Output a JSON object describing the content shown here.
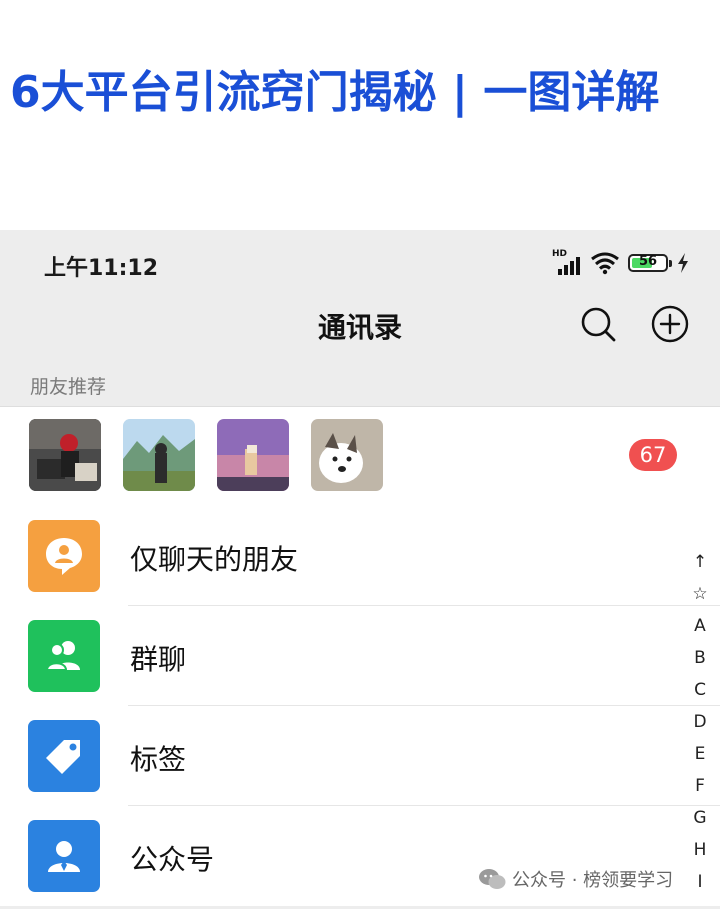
{
  "banner": {
    "title": "6大平台引流窍门揭秘 | 一图详解"
  },
  "status_bar": {
    "time": "上午11:12",
    "network": "HD",
    "battery": "56"
  },
  "nav": {
    "title": "通讯录",
    "search_icon": "search-icon",
    "add_icon": "add-circle-icon"
  },
  "section_header": "朋友推荐",
  "recommend": {
    "badge_count": "67"
  },
  "list": {
    "items": [
      {
        "label": "仅聊天的朋友",
        "icon": "chat-bubble-person-icon",
        "color": "#f5a040"
      },
      {
        "label": "群聊",
        "icon": "group-people-icon",
        "color": "#1fc15c"
      },
      {
        "label": "标签",
        "icon": "tag-icon",
        "color": "#2b82e0"
      },
      {
        "label": "公众号",
        "icon": "official-account-icon",
        "color": "#2b82e0"
      }
    ]
  },
  "index_bar": [
    "↑",
    "☆",
    "A",
    "B",
    "C",
    "D",
    "E",
    "F",
    "G",
    "H",
    "I"
  ],
  "watermark": {
    "text": "公众号 · 榜领要学习"
  },
  "colors": {
    "banner_title": "#1a4fd6",
    "badge": "#f05050",
    "background": "#ededed"
  }
}
